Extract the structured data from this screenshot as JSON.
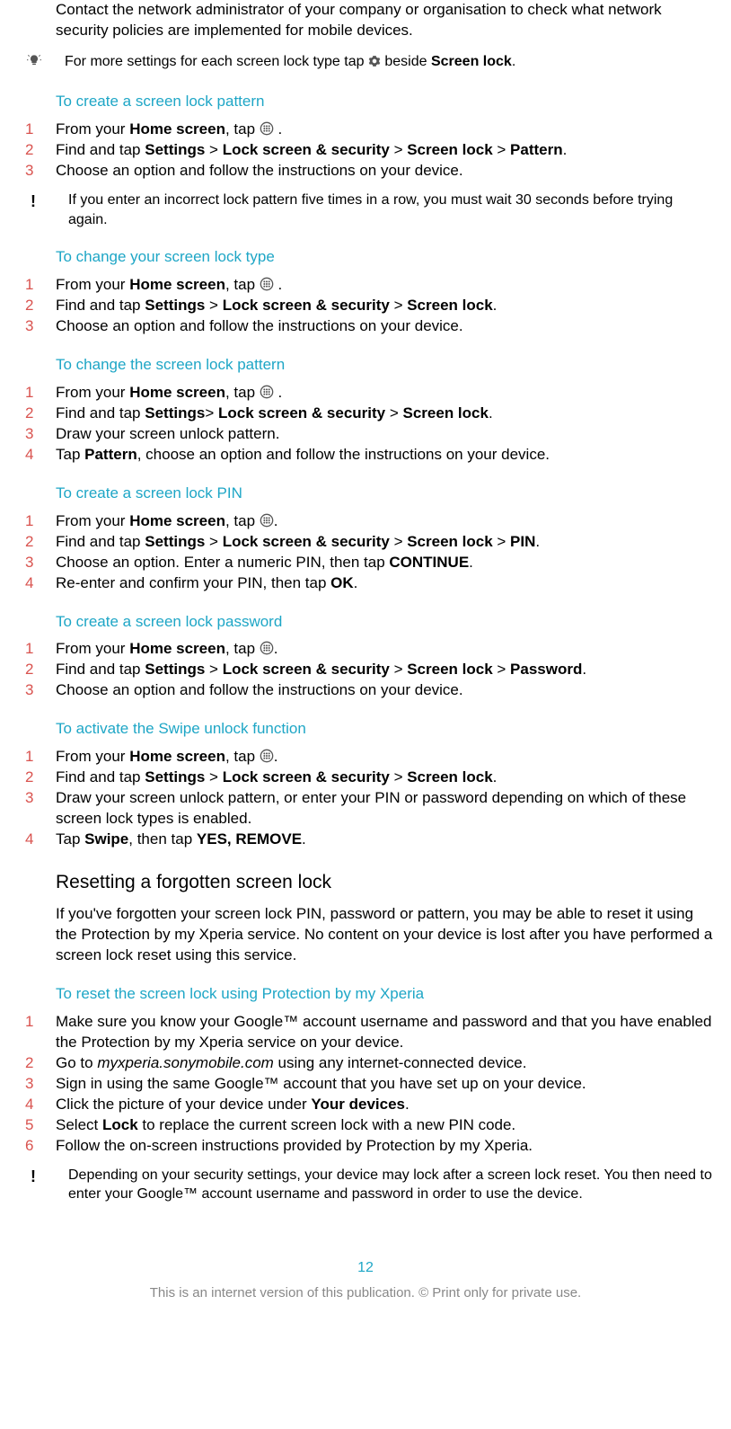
{
  "intro_para": "Contact the network administrator of your company or organisation to check what network security policies are implemented for mobile devices.",
  "tip1_a": "For more settings for each screen lock type tap ",
  "tip1_b": " beside ",
  "tip1_bold": "Screen lock",
  "tip1_c": ".",
  "sec1_title": "To create a screen lock pattern",
  "sec1_steps": {
    "s1a": "From your ",
    "s1b": "Home screen",
    "s1c": ", tap ",
    "s1d": " .",
    "s2a": "Find and tap ",
    "s2b": "Settings",
    "s2c": " > ",
    "s2d": "Lock screen & security",
    "s2e": " > ",
    "s2f": "Screen lock",
    "s2g": " > ",
    "s2h": "Pattern",
    "s2i": ".",
    "s3": "Choose an option and follow the instructions on your device."
  },
  "warn1": "If you enter an incorrect lock pattern five times in a row, you must wait 30 seconds before trying again.",
  "sec2_title": "To change your screen lock type",
  "sec2_steps": {
    "s1a": "From your ",
    "s1b": "Home screen",
    "s1c": ", tap ",
    "s1d": " .",
    "s2a": "Find and tap ",
    "s2b": "Settings",
    "s2c": " > ",
    "s2d": "Lock screen & security",
    "s2e": " > ",
    "s2f": "Screen lock",
    "s2g": ".",
    "s3": "Choose an option and follow the instructions on your device."
  },
  "sec3_title": "To change the screen lock pattern",
  "sec3_steps": {
    "s1a": "From your ",
    "s1b": "Home screen",
    "s1c": ", tap ",
    "s1d": " .",
    "s2a": "Find and tap ",
    "s2b": "Settings",
    "s2c": "> ",
    "s2d": "Lock screen & security",
    "s2e": " > ",
    "s2f": "Screen lock",
    "s2g": ".",
    "s3": "Draw your screen unlock pattern.",
    "s4a": "Tap ",
    "s4b": "Pattern",
    "s4c": ", choose an option and follow the instructions on your device."
  },
  "sec4_title": "To create a screen lock PIN",
  "sec4_steps": {
    "s1a": "From your ",
    "s1b": "Home screen",
    "s1c": ", tap ",
    "s1d": ".",
    "s2a": "Find and tap ",
    "s2b": "Settings",
    "s2c": " > ",
    "s2d": "Lock screen & security",
    "s2e": " > ",
    "s2f": "Screen lock",
    "s2g": " > ",
    "s2h": "PIN",
    "s2i": ".",
    "s3a": "Choose an option. Enter a numeric PIN, then tap ",
    "s3b": "CONTINUE",
    "s3c": ".",
    "s4a": "Re-enter and confirm your PIN, then tap ",
    "s4b": "OK",
    "s4c": "."
  },
  "sec5_title": "To create a screen lock password",
  "sec5_steps": {
    "s1a": "From your ",
    "s1b": "Home screen",
    "s1c": ", tap ",
    "s1d": ".",
    "s2a": "Find and tap ",
    "s2b": "Settings",
    "s2c": " > ",
    "s2d": "Lock screen & security",
    "s2e": " > ",
    "s2f": "Screen lock",
    "s2g": " > ",
    "s2h": "Password",
    "s2i": ".",
    "s3": "Choose an option and follow the instructions on your device."
  },
  "sec6_title": "To activate the Swipe unlock function",
  "sec6_steps": {
    "s1a": "From your ",
    "s1b": "Home screen",
    "s1c": ", tap ",
    "s1d": ".",
    "s2a": "Find and tap ",
    "s2b": "Settings",
    "s2c": " > ",
    "s2d": "Lock screen & security",
    "s2e": " > ",
    "s2f": "Screen lock",
    "s2g": ".",
    "s3": "Draw your screen unlock pattern, or enter your PIN or password depending on which of these screen lock types is enabled.",
    "s4a": "Tap ",
    "s4b": "Swipe",
    "s4c": ", then tap ",
    "s4d": "YES, REMOVE",
    "s4e": "."
  },
  "h2_reset": "Resetting a forgotten screen lock",
  "reset_para": "If you've forgotten your screen lock PIN, password or pattern, you may be able to reset it using the Protection by my Xperia service. No content on your device is lost after you have performed a screen lock reset using this service.",
  "sec7_title": "To reset the screen lock using Protection by my Xperia",
  "sec7_steps": {
    "s1": "Make sure you know your Google™ account username and password and that you have enabled the Protection by my Xperia service on your device.",
    "s2a": "Go to ",
    "s2b": "myxperia.sonymobile.com",
    "s2c": " using any internet-connected device.",
    "s3": "Sign in using the same Google™ account that you have set up on your device.",
    "s4a": "Click the picture of your device under ",
    "s4b": "Your devices",
    "s4c": ".",
    "s5a": "Select ",
    "s5b": "Lock",
    "s5c": " to replace the current screen lock with a new PIN code.",
    "s6": "Follow the on-screen instructions provided by Protection by my Xperia."
  },
  "warn2": "Depending on your security settings, your device may lock after a screen lock reset. You then need to enter your Google™ account username and password in order to use the device.",
  "page_number": "12",
  "footer": "This is an internet version of this publication. © Print only for private use."
}
